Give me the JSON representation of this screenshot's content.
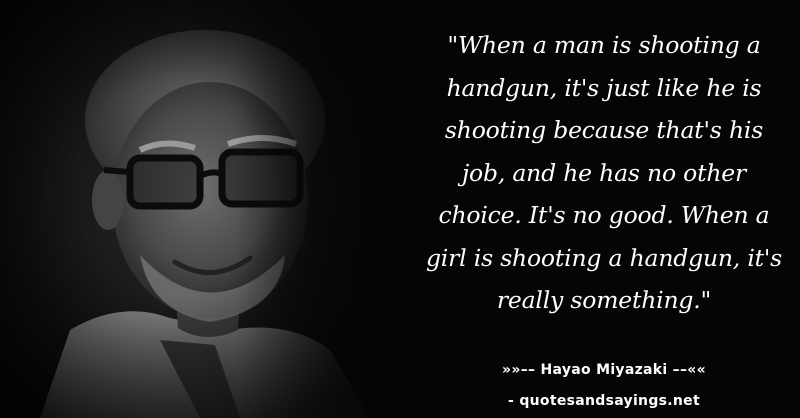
{
  "quote": {
    "text": "\"When a man is shooting a handgun, it's just like he is shooting because that's his job, and he has no other choice. It's no good. When a girl is shooting a handgun, it's really something.\""
  },
  "attribution": {
    "author_line": "»»–– Hayao Miyazaki ––««",
    "source_line": "- quotesandsayings.net"
  },
  "colors": {
    "background": "#050505",
    "text": "#ffffff"
  }
}
